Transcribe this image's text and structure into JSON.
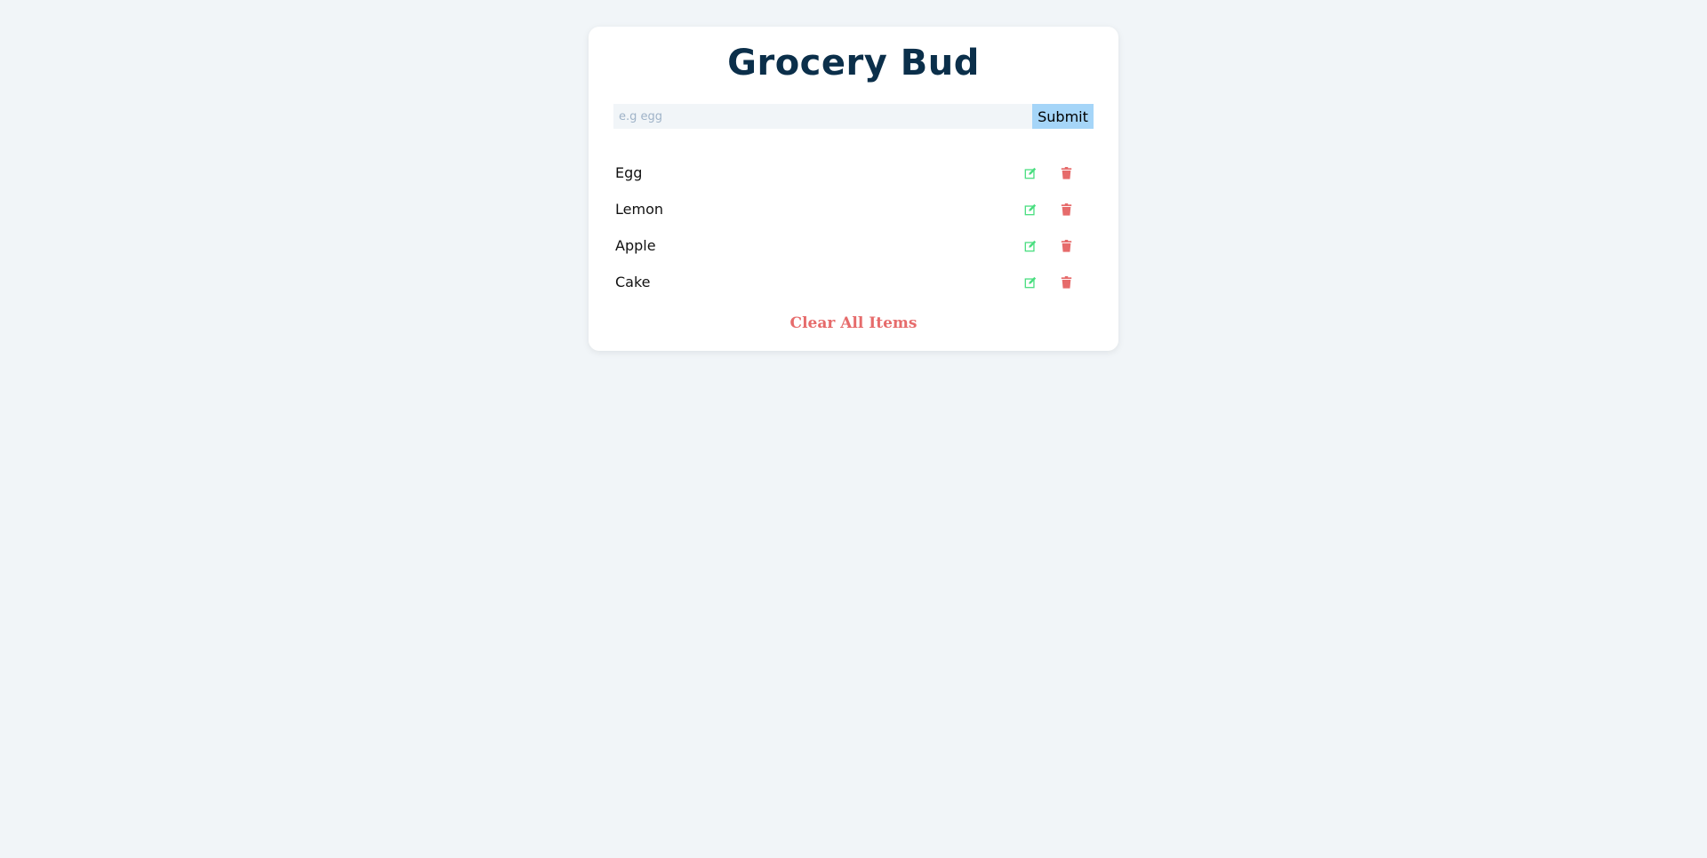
{
  "app": {
    "title": "Grocery Bud"
  },
  "form": {
    "placeholder": "e.g egg",
    "value": "",
    "submit_label": "Submit"
  },
  "items": [
    {
      "label": "Egg"
    },
    {
      "label": "Lemon"
    },
    {
      "label": "Apple"
    },
    {
      "label": "Cake"
    }
  ],
  "actions": {
    "clear_label": "Clear All Items",
    "edit_icon": "edit-icon",
    "delete_icon": "trash-icon"
  },
  "colors": {
    "background": "#f1f5f8",
    "title": "#0b2f4a",
    "submit_bg": "#a5d5f8",
    "edit": "#4ade80",
    "delete": "#e66b6b",
    "clear": "#e66b6b"
  }
}
